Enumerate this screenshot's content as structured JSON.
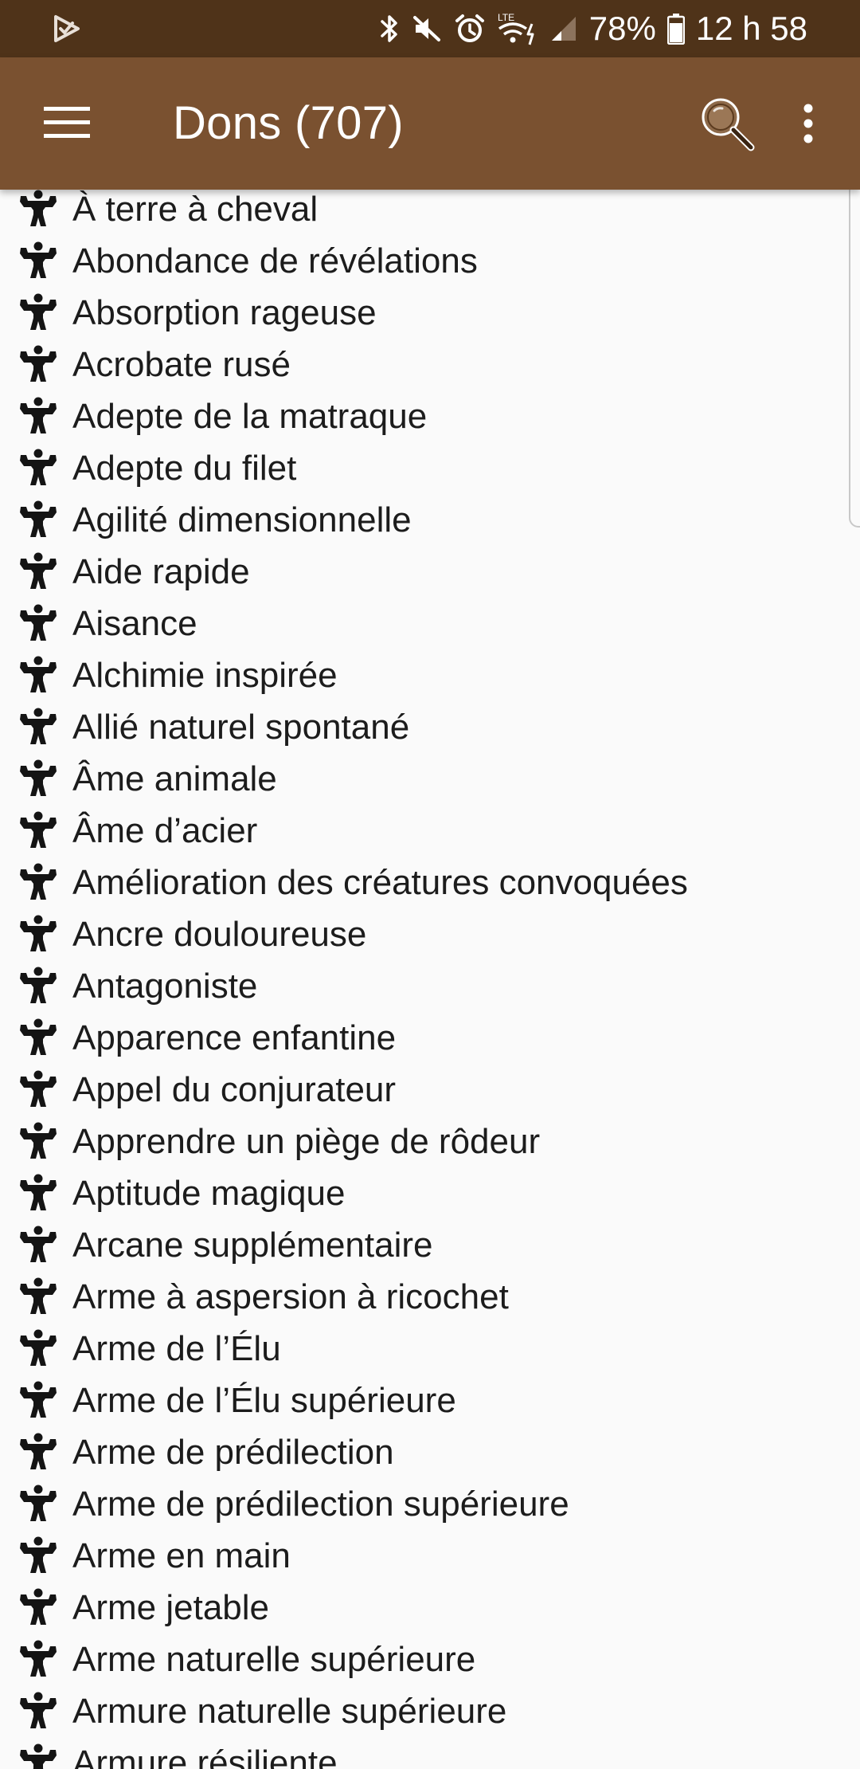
{
  "status_bar": {
    "battery_percent": "78%",
    "time": "12 h 58",
    "network_label": "LTE",
    "icons": [
      "app-notification-icon",
      "bluetooth-icon",
      "mute-icon",
      "alarm-icon",
      "wifi-lte-icon",
      "signal-icon",
      "battery-icon"
    ]
  },
  "app_bar": {
    "title": "Dons (707)",
    "menu_icon": "hamburger-menu-icon",
    "search_icon": "search-icon",
    "overflow_icon": "more-vert-icon"
  },
  "colors": {
    "status_bar": "#4f3319",
    "app_bar": "#7a5130",
    "background": "#fafafa",
    "text": "#1c1c1c"
  },
  "list": {
    "item_icon": "muscle-figure-icon",
    "items": [
      "À terre à cheval",
      "Abondance de révélations",
      "Absorption rageuse",
      "Acrobate rusé",
      "Adepte de la matraque",
      "Adepte du filet",
      "Agilité dimensionnelle",
      "Aide rapide",
      "Aisance",
      "Alchimie inspirée",
      "Allié naturel spontané",
      "Âme animale",
      "Âme d’acier",
      "Amélioration des créatures convoquées",
      "Ancre douloureuse",
      "Antagoniste",
      "Apparence enfantine",
      "Appel du conjurateur",
      "Apprendre un piège de rôdeur",
      "Aptitude magique",
      "Arcane supplémentaire",
      "Arme à aspersion à ricochet",
      "Arme de l’Élu",
      "Arme de l’Élu supérieure",
      "Arme de prédilection",
      "Arme de prédilection supérieure",
      "Arme en main",
      "Arme jetable",
      "Arme naturelle supérieure",
      "Armure naturelle supérieure",
      "Armure résiliente"
    ]
  }
}
